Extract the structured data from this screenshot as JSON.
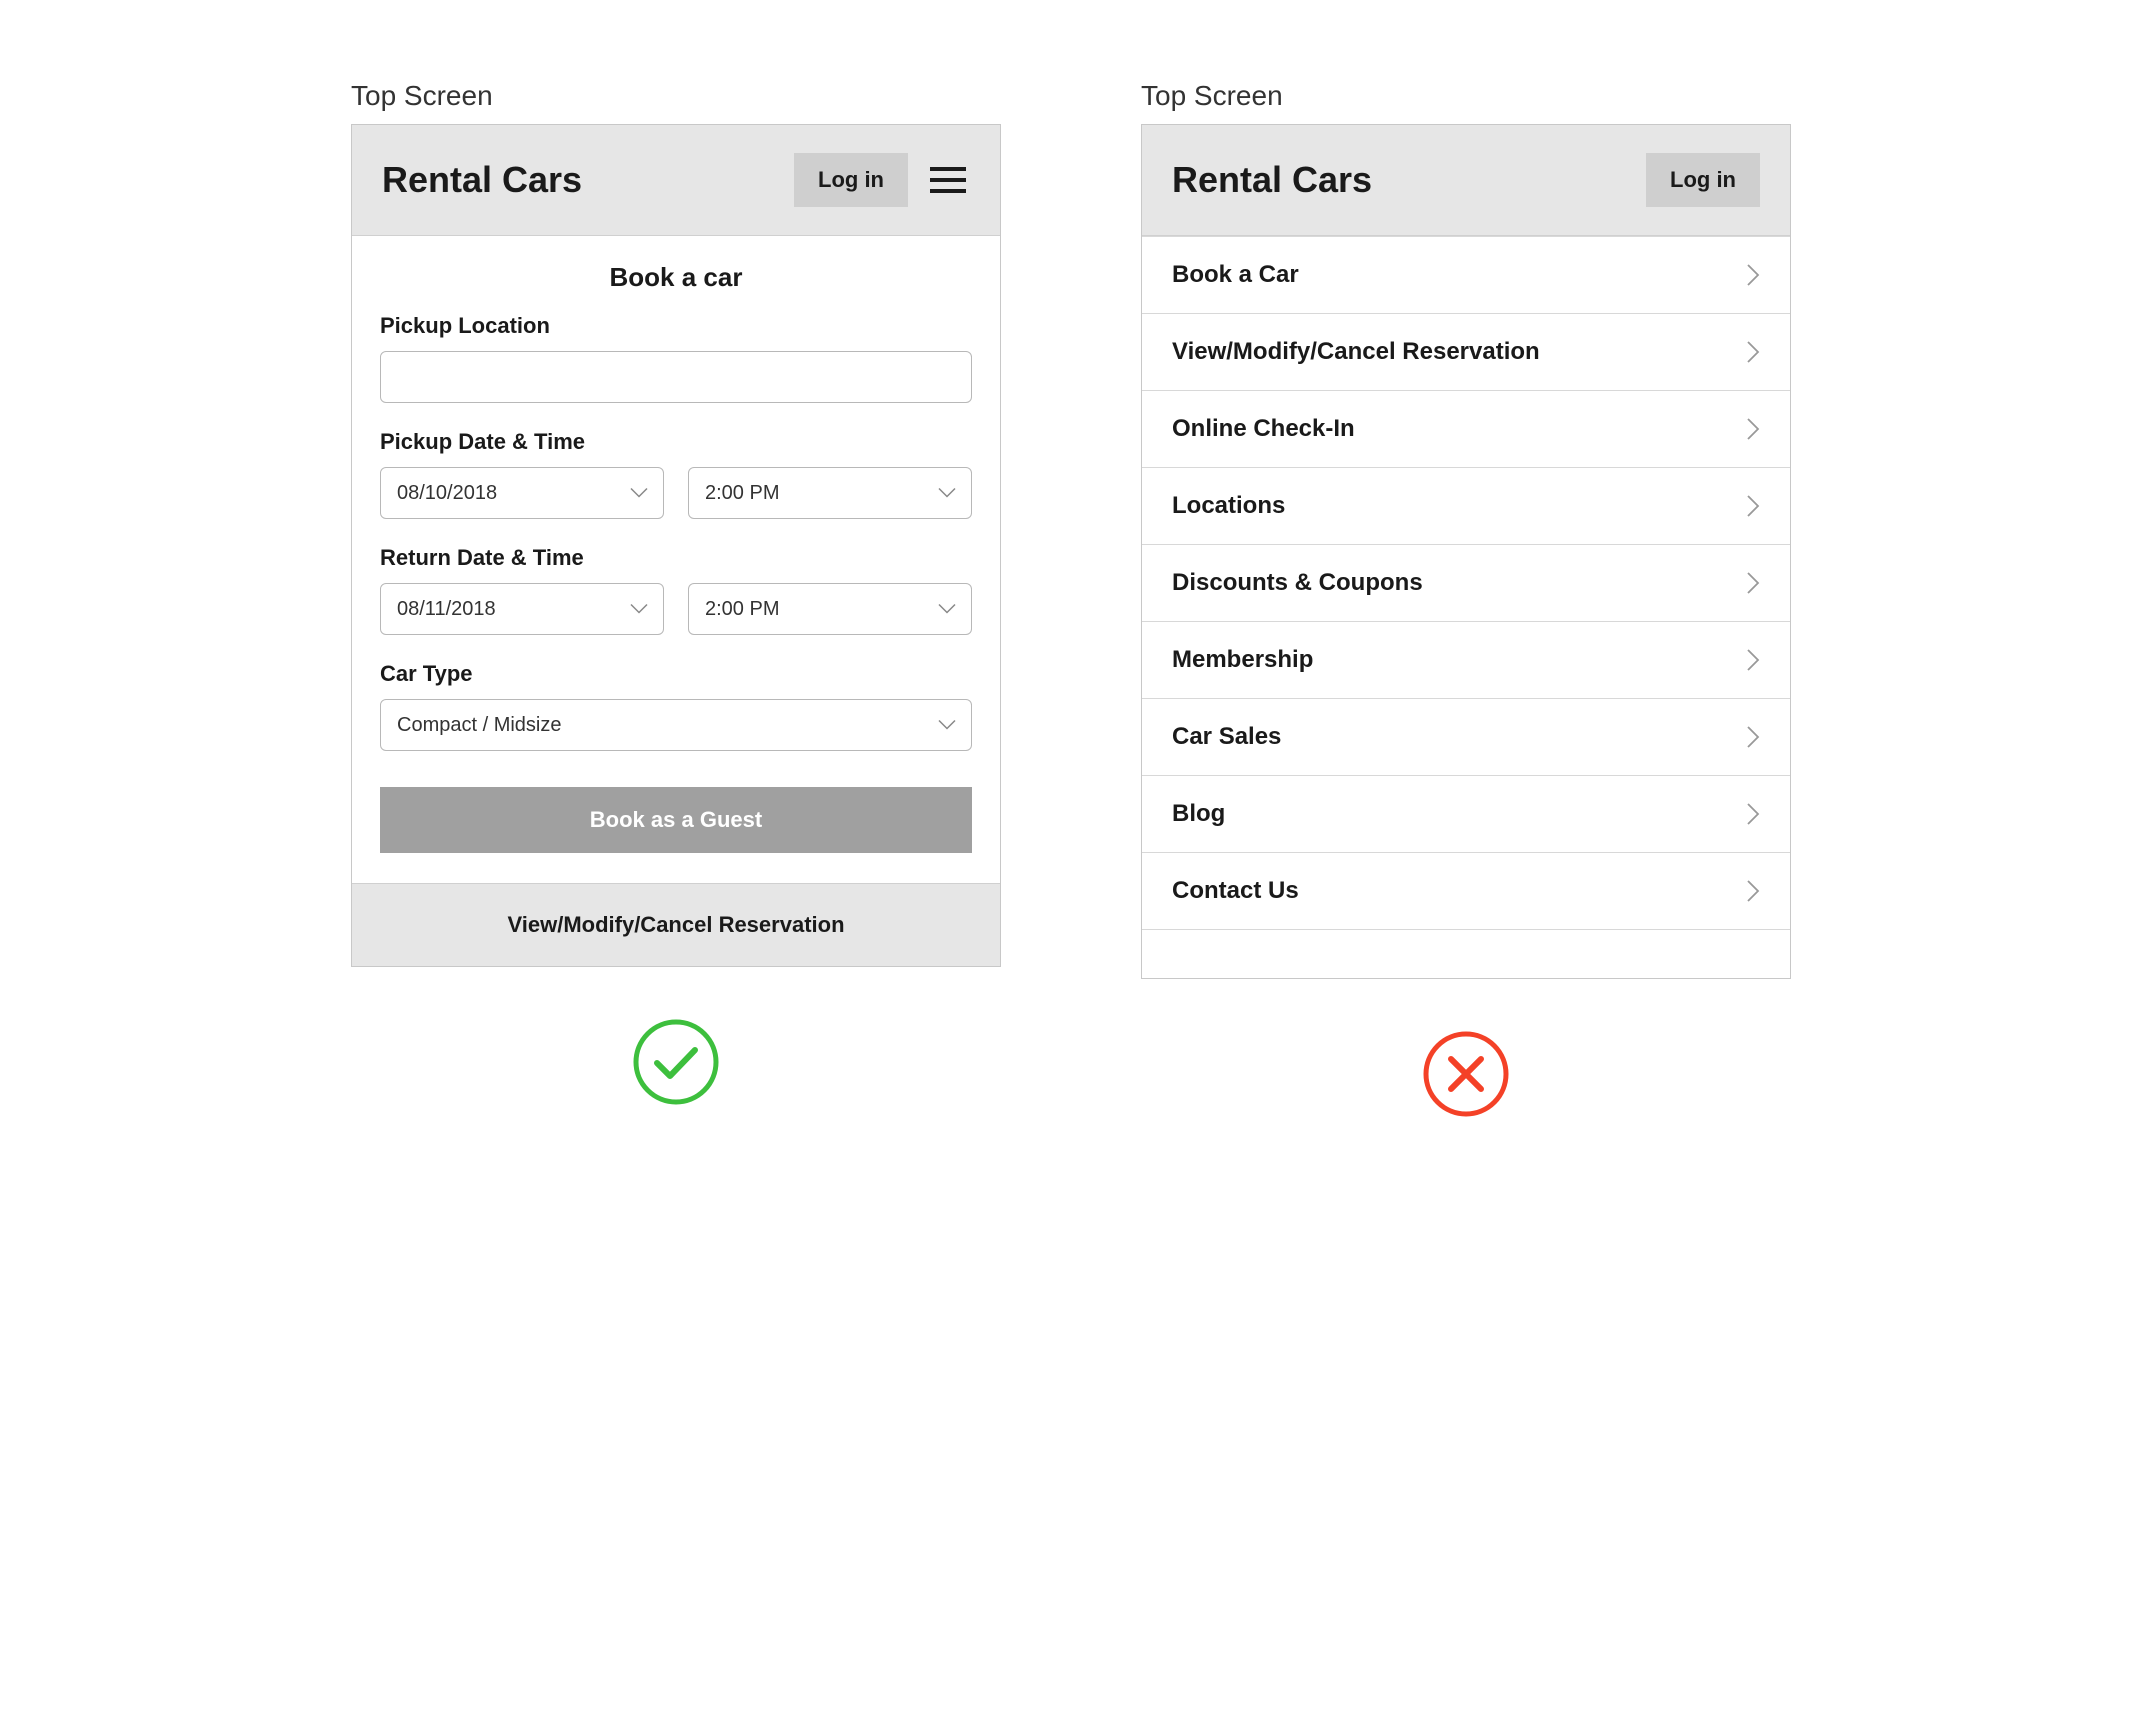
{
  "left": {
    "screen_label": "Top Screen",
    "header": {
      "title": "Rental Cars",
      "login_label": "Log in"
    },
    "form": {
      "title": "Book a car",
      "pickup_location_label": "Pickup Location",
      "pickup_location_value": "",
      "pickup_datetime_label": "Pickup Date & Time",
      "pickup_date_value": "08/10/2018",
      "pickup_time_value": "2:00 PM",
      "return_datetime_label": "Return Date & Time",
      "return_date_value": "08/11/2018",
      "return_time_value": "2:00 PM",
      "car_type_label": "Car Type",
      "car_type_value": "Compact / Midsize",
      "submit_label": "Book as a Guest"
    },
    "footer_link_label": "View/Modify/Cancel Reservation",
    "badge": "check"
  },
  "right": {
    "screen_label": "Top Screen",
    "header": {
      "title": "Rental Cars",
      "login_label": "Log in"
    },
    "menu_items": [
      "Book a Car",
      "View/Modify/Cancel Reservation",
      "Online Check-In",
      "Locations",
      "Discounts & Coupons",
      "Membership",
      "Car Sales",
      "Blog",
      "Contact Us"
    ],
    "badge": "cross"
  }
}
